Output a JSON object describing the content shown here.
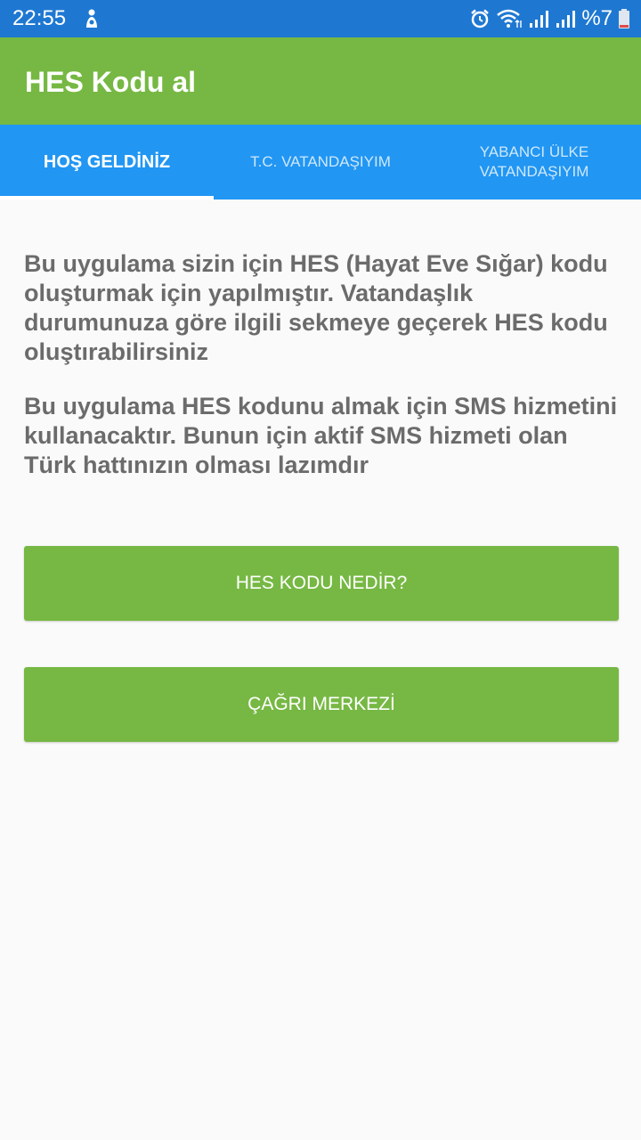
{
  "status_bar": {
    "time": "22:55",
    "battery_text": "%7",
    "icons": [
      "notification-icon",
      "alarm-icon",
      "wifi-icon",
      "signal-icon",
      "battery-icon"
    ]
  },
  "app_bar": {
    "title": "HES Kodu al",
    "color": "#76b843"
  },
  "tabs": [
    {
      "label": "HOŞ GELDİNİZ",
      "active": true
    },
    {
      "label": "T.C. VATANDAŞIYIM",
      "active": false
    },
    {
      "label_line1": "YABANCI ÜLKE",
      "label_line2": "VATANDAŞIYIM",
      "active": false
    }
  ],
  "content": {
    "paragraph1": "Bu uygulama sizin için HES (Hayat Eve Sığar) kodu oluşturmak için yapılmıştır. Vatandaşlık durumunuza göre ilgili sekmeye geçerek HES kodu oluştırabilirsiniz",
    "paragraph2": "Bu uygulama HES kodunu almak için SMS hizmetini kullanacaktır. Bunun için aktif SMS hizmeti olan Türk hattınızın olması lazımdır"
  },
  "buttons": {
    "what_is_hes": "HES KODU NEDİR?",
    "call_center": "ÇAĞRI MERKEZİ"
  },
  "colors": {
    "status_bar": "#1e78d2",
    "tab_bar": "#2196f3",
    "accent_green": "#76b843",
    "text": "#6b6b6b"
  }
}
